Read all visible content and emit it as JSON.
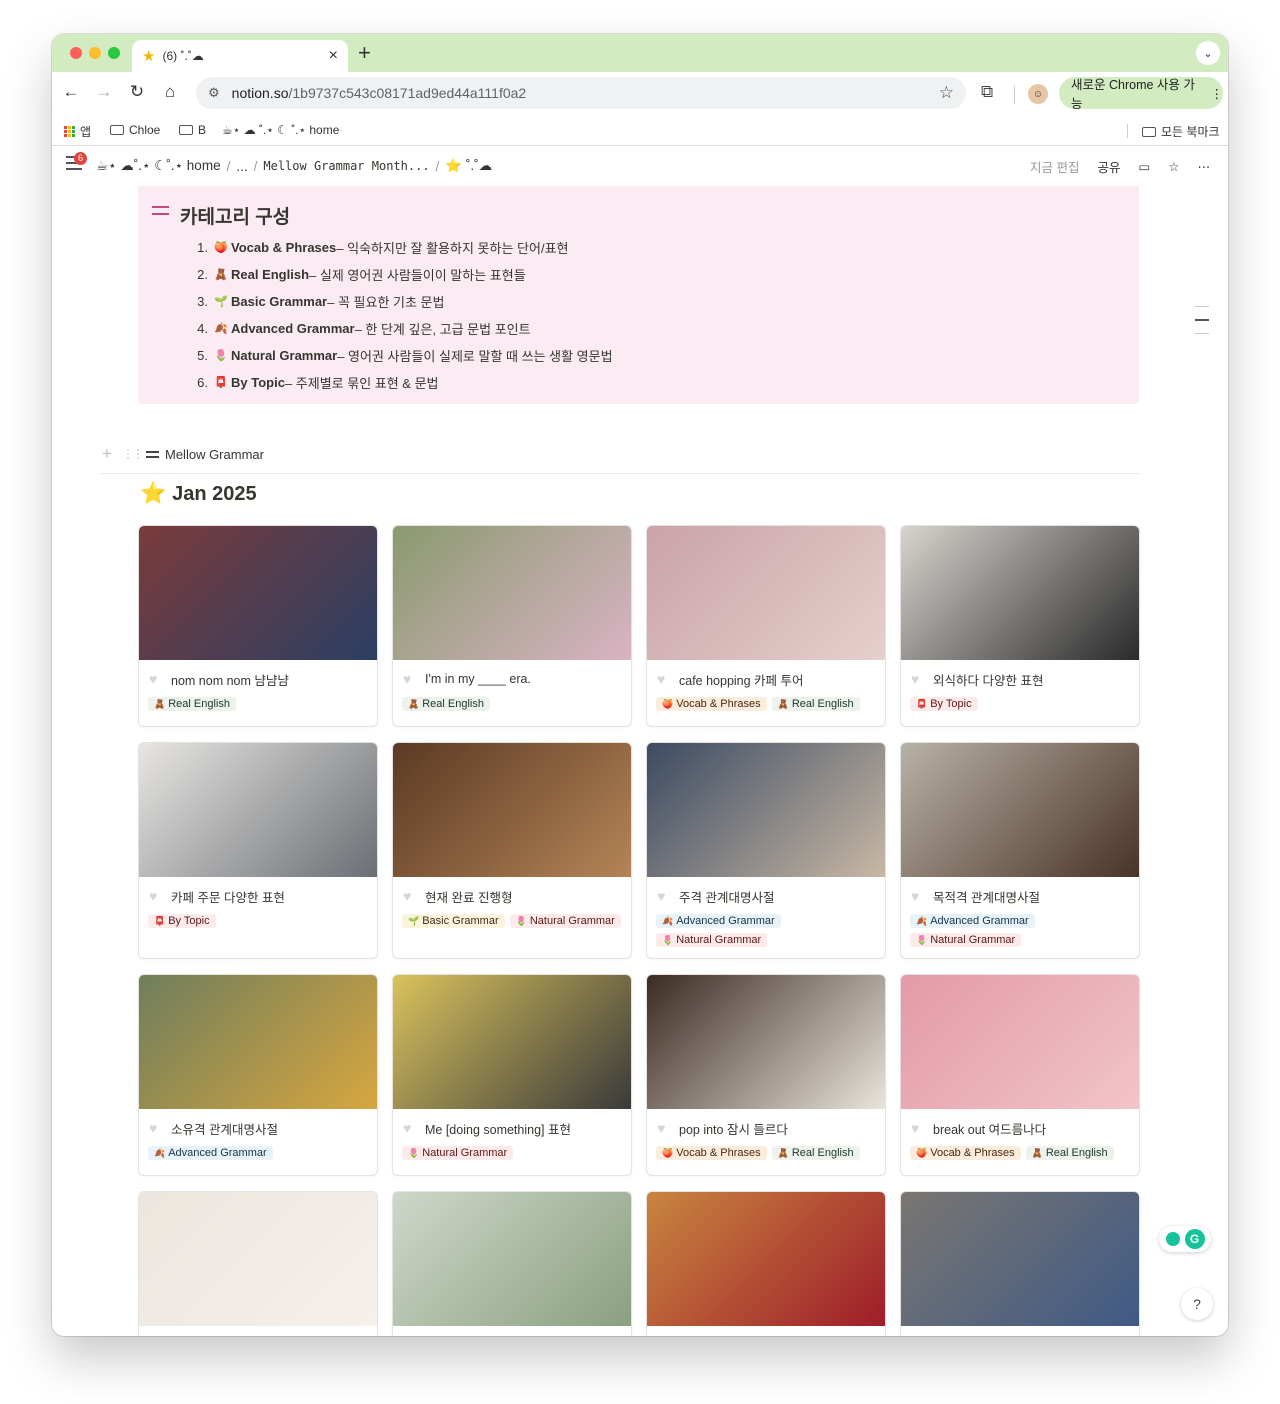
{
  "browser": {
    "tab_title": "(6) ˚.˚☁",
    "tab_favicon": "star-icon",
    "url_domain": "notion.so",
    "url_path": "/1b9737c543c08171ad9ed44a111f0a2",
    "update_label": "새로운 Chrome 사용 가능",
    "bookmarks": [
      {
        "label": "앱",
        "icon": "apps-grid-icon"
      },
      {
        "label": "Chloe",
        "icon": "folder-icon"
      },
      {
        "label": "B",
        "icon": "folder-icon"
      },
      {
        "label": "☕︎⋆ ☁ ˚.⋆ ☾ ˚.⋆ home",
        "icon": ""
      }
    ],
    "all_bookmarks": "모든 북마크"
  },
  "notion": {
    "notification_count": "6",
    "breadcrumb": [
      "☕︎⋆ ☁˚.⋆ ☾˚.⋆ home",
      "...",
      "Mellow Grammar Month...",
      "⭐ ˚.˚☁"
    ],
    "edited": "지금 편집",
    "share": "공유"
  },
  "callout": {
    "title": "카테고리 구성",
    "items": [
      {
        "num": "1.",
        "emoji": "🍑",
        "name": "Vocab & Phrases",
        "desc": " – 익숙하지만 잘 활용하지 못하는 단어/표현"
      },
      {
        "num": "2.",
        "emoji": "🧸",
        "name": "Real English",
        "desc": " – 실제 영어권 사람들이이 말하는 표현들"
      },
      {
        "num": "3.",
        "emoji": "🌱",
        "name": "Basic Grammar",
        "desc": " – 꼭 필요한 기초 문법"
      },
      {
        "num": "4.",
        "emoji": "🍂",
        "name": "Advanced Grammar",
        "desc": " – 한 단계 깊은, 고급 문법 포인트"
      },
      {
        "num": "5.",
        "emoji": "🌷",
        "name": "Natural Grammar",
        "desc": " – 영어권 사람들이 실제로 말할 때 쓰는 생활 영문법"
      },
      {
        "num": "6.",
        "emoji": "📮",
        "name": "By Topic",
        "desc": " – 주제별로 묶인 표현 & 문법"
      }
    ]
  },
  "view": {
    "name": "Mellow Grammar"
  },
  "group": {
    "emoji": "⭐",
    "title": "Jan 2025"
  },
  "cards": [
    {
      "title": "nom nom nom 냠냠냠",
      "cover": [
        "#7a3b3b",
        "#2b3f63"
      ],
      "tags": [
        {
          "label": "Real English",
          "emoji": "🧸",
          "kind": "real"
        }
      ]
    },
    {
      "title": "I'm in my ____ era.",
      "cover": [
        "#8a9a6f",
        "#d9b3c4"
      ],
      "tags": [
        {
          "label": "Real English",
          "emoji": "🧸",
          "kind": "real"
        }
      ]
    },
    {
      "title": "cafe hopping 카페 투어",
      "cover": [
        "#c9a3a8",
        "#e6cfcc"
      ],
      "tags": [
        {
          "label": "Vocab & Phrases",
          "emoji": "🍑",
          "kind": "vocab"
        },
        {
          "label": "Real English",
          "emoji": "🧸",
          "kind": "real"
        }
      ]
    },
    {
      "title": "외식하다 다양한 표현",
      "cover": [
        "#d8d4cf",
        "#2a2a2a"
      ],
      "tags": [
        {
          "label": "By Topic",
          "emoji": "📮",
          "kind": "topic"
        }
      ]
    },
    {
      "title": "카페 주문 다양한 표현",
      "cover": [
        "#e8e6e3",
        "#6b6f74"
      ],
      "tags": [
        {
          "label": "By Topic",
          "emoji": "📮",
          "kind": "topic"
        }
      ]
    },
    {
      "title": "현재 완료 진행형",
      "cover": [
        "#5a3a24",
        "#b58456"
      ],
      "tags": [
        {
          "label": "Basic Grammar",
          "emoji": "🌱",
          "kind": "basic"
        },
        {
          "label": "Natural Grammar",
          "emoji": "🌷",
          "kind": "nat"
        }
      ]
    },
    {
      "title": "주격 관계대명사절",
      "cover": [
        "#3c4a62",
        "#c7b8a4"
      ],
      "tags": [
        {
          "label": "Advanced Grammar",
          "emoji": "🍂",
          "kind": "adv"
        },
        {
          "label": "Natural Grammar",
          "emoji": "🌷",
          "kind": "nat"
        }
      ]
    },
    {
      "title": "목적격 관계대명사절",
      "cover": [
        "#b8b2a6",
        "#4a3326"
      ],
      "tags": [
        {
          "label": "Advanced Grammar",
          "emoji": "🍂",
          "kind": "adv"
        },
        {
          "label": "Natural Grammar",
          "emoji": "🌷",
          "kind": "nat"
        }
      ]
    },
    {
      "title": "소유격 관계대명사절",
      "cover": [
        "#6f7e5c",
        "#d7a63f"
      ],
      "tags": [
        {
          "label": "Advanced Grammar",
          "emoji": "🍂",
          "kind": "adv"
        }
      ]
    },
    {
      "title": "Me [doing something] 표현",
      "cover": [
        "#d9c25c",
        "#3a3a3a"
      ],
      "tags": [
        {
          "label": "Natural Grammar",
          "emoji": "🌷",
          "kind": "nat"
        }
      ]
    },
    {
      "title": "pop into 잠시 들르다",
      "cover": [
        "#3b2b22",
        "#e9e4dc"
      ],
      "tags": [
        {
          "label": "Vocab & Phrases",
          "emoji": "🍑",
          "kind": "vocab"
        },
        {
          "label": "Real English",
          "emoji": "🧸",
          "kind": "real"
        }
      ]
    },
    {
      "title": "break out 여드름나다",
      "cover": [
        "#e39aa7",
        "#f2c4c9"
      ],
      "tags": [
        {
          "label": "Vocab & Phrases",
          "emoji": "🍑",
          "kind": "vocab"
        },
        {
          "label": "Real English",
          "emoji": "🧸",
          "kind": "real"
        }
      ]
    },
    {
      "title": "",
      "cover": [
        "#ece6df",
        "#f5f0ea"
      ],
      "tags": []
    },
    {
      "title": "",
      "cover": [
        "#cfd7c9",
        "#8aa07f"
      ],
      "tags": []
    },
    {
      "title": "",
      "cover": [
        "#c9853f",
        "#9e1d2a"
      ],
      "tags": []
    },
    {
      "title": "",
      "cover": [
        "#7a7672",
        "#3f5a84"
      ],
      "tags": []
    }
  ]
}
